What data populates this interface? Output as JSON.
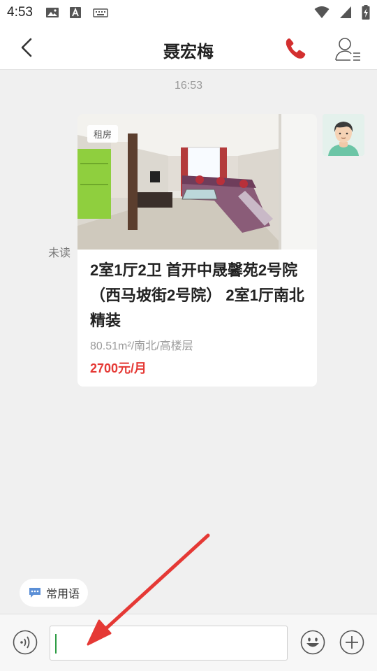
{
  "status_bar": {
    "time": "4:53",
    "left_icons": [
      "gallery-icon",
      "font-a-icon",
      "keyboard-icon"
    ],
    "right_icons": [
      "wifi-icon",
      "signal-icon",
      "battery-charging-icon"
    ]
  },
  "header": {
    "title": "聂宏梅",
    "back_icon": "chevron-left-icon",
    "call_icon": "phone-icon",
    "profile_icon": "contact-card-icon"
  },
  "chat": {
    "timestamp": "16:53",
    "read_status": "未读",
    "message_card": {
      "tag": "租房",
      "title": "2室1厅2卫 首开中晟馨苑2号院（西马坡街2号院） 2室1厅南北 精装",
      "meta": "80.51m²/南北/高楼层",
      "price": "2700元/月"
    }
  },
  "quick_phrases": {
    "label": "常用语",
    "icon": "chat-bubble-dots-icon"
  },
  "input_bar": {
    "value": "",
    "voice_icon": "voice-icon",
    "emoji_icon": "smile-icon",
    "plus_icon": "plus-icon"
  },
  "colors": {
    "accent_red": "#e53935",
    "phone_red": "#d32f2f",
    "caret_green": "#2e9d45",
    "annotation_arrow": "#e53935"
  }
}
